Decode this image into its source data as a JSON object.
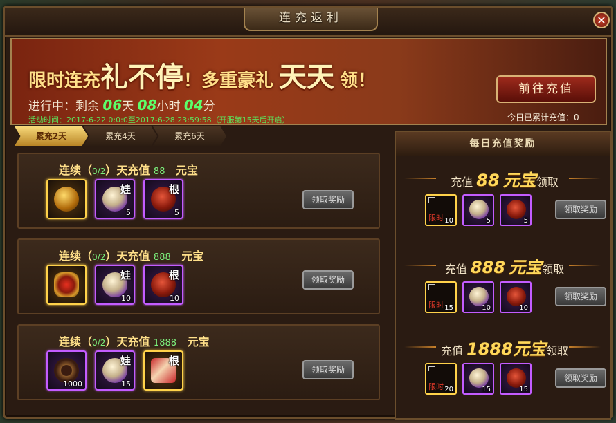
{
  "window": {
    "title": "连充返利",
    "close_symbol": "✕"
  },
  "banner": {
    "slogan_1": "限时连充",
    "slogan_2": "礼不停",
    "slogan_3": "！多重豪礼",
    "slogan_4": "天天",
    "slogan_5": "领！",
    "progress_prefix": "进行中：剩余",
    "days": "06",
    "days_unit": "天",
    "hours": "08",
    "hours_unit": "小时",
    "minutes": "04",
    "minutes_unit": "分",
    "event_time": "活动时间：2017-6-22 0:0:0至2017-6-28 23:59:58（开服第15天后开启）",
    "go_button": "前往充值",
    "today_total_label": "今日已累计充值：",
    "today_total_value": "0"
  },
  "tabs": [
    {
      "label": "累充2天",
      "active": true
    },
    {
      "label": "累充4天",
      "active": false
    },
    {
      "label": "累充6天",
      "active": false
    }
  ],
  "rows": [
    {
      "prefix": "连续（",
      "progress": "0/2",
      "mid": "）天充值",
      "amount": "88",
      "unit": "元宝",
      "items": [
        {
          "icon": "gold-coin-icon",
          "kind": "coin",
          "frame": "gold",
          "tag": "",
          "count": ""
        },
        {
          "icon": "pearl-orb-icon",
          "kind": "pearl",
          "frame": "purple",
          "tag": "娃",
          "count": "5"
        },
        {
          "icon": "root-orb-icon",
          "kind": "root",
          "frame": "purple",
          "tag": "根",
          "count": "5"
        }
      ],
      "claim": "领取奖励"
    },
    {
      "prefix": "连续（",
      "progress": "0/2",
      "mid": "）天充值",
      "amount": "888",
      "unit": "元宝",
      "items": [
        {
          "icon": "dragon-emblem-icon",
          "kind": "dragon",
          "frame": "gold",
          "tag": "",
          "count": ""
        },
        {
          "icon": "pearl-orb-icon",
          "kind": "pearl",
          "frame": "purple",
          "tag": "娃",
          "count": "10"
        },
        {
          "icon": "root-orb-icon",
          "kind": "root",
          "frame": "purple",
          "tag": "根",
          "count": "10"
        }
      ],
      "claim": "领取奖励"
    },
    {
      "prefix": "连续（",
      "progress": "0/2",
      "mid": "）天充值",
      "amount": "1888",
      "unit": "元宝",
      "items": [
        {
          "icon": "gem-ring-icon",
          "kind": "ring",
          "frame": "purple",
          "tag": "",
          "count": "1000"
        },
        {
          "icon": "pearl-orb-icon",
          "kind": "pearl",
          "frame": "purple",
          "tag": "娃",
          "count": "15"
        },
        {
          "icon": "scroll-icon",
          "kind": "scroll",
          "frame": "gold",
          "tag": "根",
          "count": ""
        }
      ],
      "claim": "领取奖励"
    }
  ],
  "side": {
    "title": "每日充值奖励",
    "tiers": [
      {
        "w1": "充值",
        "amount": "88",
        "unit": "元宝",
        "w2": "领取",
        "items": [
          {
            "kind": "empty",
            "frame": "gold",
            "limit": "限时",
            "count": "10"
          },
          {
            "kind": "pearl",
            "frame": "purple",
            "limit": "",
            "count": "5"
          },
          {
            "kind": "root",
            "frame": "purple",
            "limit": "",
            "count": "5"
          }
        ],
        "claim": "领取奖励"
      },
      {
        "w1": "充值",
        "amount": "888",
        "unit": "元宝",
        "w2": "领取",
        "items": [
          {
            "kind": "empty",
            "frame": "gold",
            "limit": "限时",
            "count": "15"
          },
          {
            "kind": "pearl",
            "frame": "purple",
            "limit": "",
            "count": "10"
          },
          {
            "kind": "root",
            "frame": "purple",
            "limit": "",
            "count": "10"
          }
        ],
        "claim": "领取奖励"
      },
      {
        "w1": "充值",
        "amount": "1888",
        "unit": "元宝",
        "w2": "领取",
        "items": [
          {
            "kind": "empty",
            "frame": "gold",
            "limit": "限时",
            "count": "20"
          },
          {
            "kind": "pearl",
            "frame": "purple",
            "limit": "",
            "count": "15"
          },
          {
            "kind": "root",
            "frame": "purple",
            "limit": "",
            "count": "15"
          }
        ],
        "claim": "领取奖励"
      }
    ]
  },
  "colors": {
    "gold": "#ffd24a",
    "purple": "#c35cff",
    "accent_green": "#5cff6a",
    "banner_red": "#9a3a18"
  }
}
